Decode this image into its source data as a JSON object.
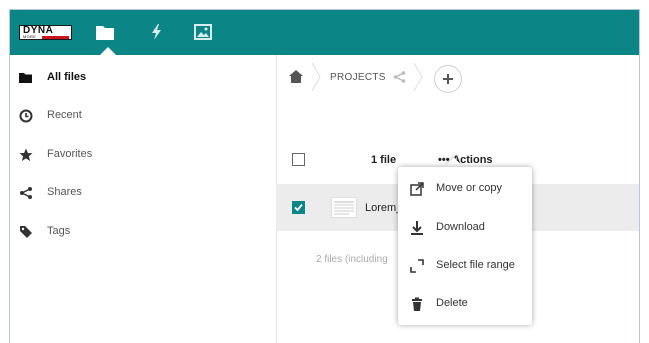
{
  "app": {
    "logo_text": "DYNA",
    "logo_subtext": "MORE"
  },
  "topbar": {
    "apps": [
      {
        "name": "Files",
        "icon": "folder-icon"
      },
      {
        "name": "Activity",
        "icon": "lightning-icon"
      },
      {
        "name": "Gallery",
        "icon": "image-icon"
      }
    ]
  },
  "sidebar": {
    "items": [
      {
        "label": "All files",
        "icon": "folder-icon",
        "active": true
      },
      {
        "label": "Recent",
        "icon": "clock-icon"
      },
      {
        "label": "Favorites",
        "icon": "star-icon"
      },
      {
        "label": "Shares",
        "icon": "share-icon"
      },
      {
        "label": "Tags",
        "icon": "tag-icon"
      }
    ]
  },
  "breadcrumb": {
    "folder": "PROJECTS"
  },
  "file_list": {
    "count_label": "1 file",
    "actions_label": "••• Actions",
    "files": [
      {
        "name": "Lorem_",
        "selected": true
      }
    ],
    "summary": "2 files (including"
  },
  "actions_menu": {
    "items": [
      {
        "label": "Move or copy",
        "icon": "move-icon"
      },
      {
        "label": "Download",
        "icon": "download-icon"
      },
      {
        "label": "Select file range",
        "icon": "select-range-icon"
      },
      {
        "label": "Delete",
        "icon": "trash-icon"
      }
    ]
  },
  "colors": {
    "brand": "#0b8586",
    "selected_row": "#ececec"
  }
}
